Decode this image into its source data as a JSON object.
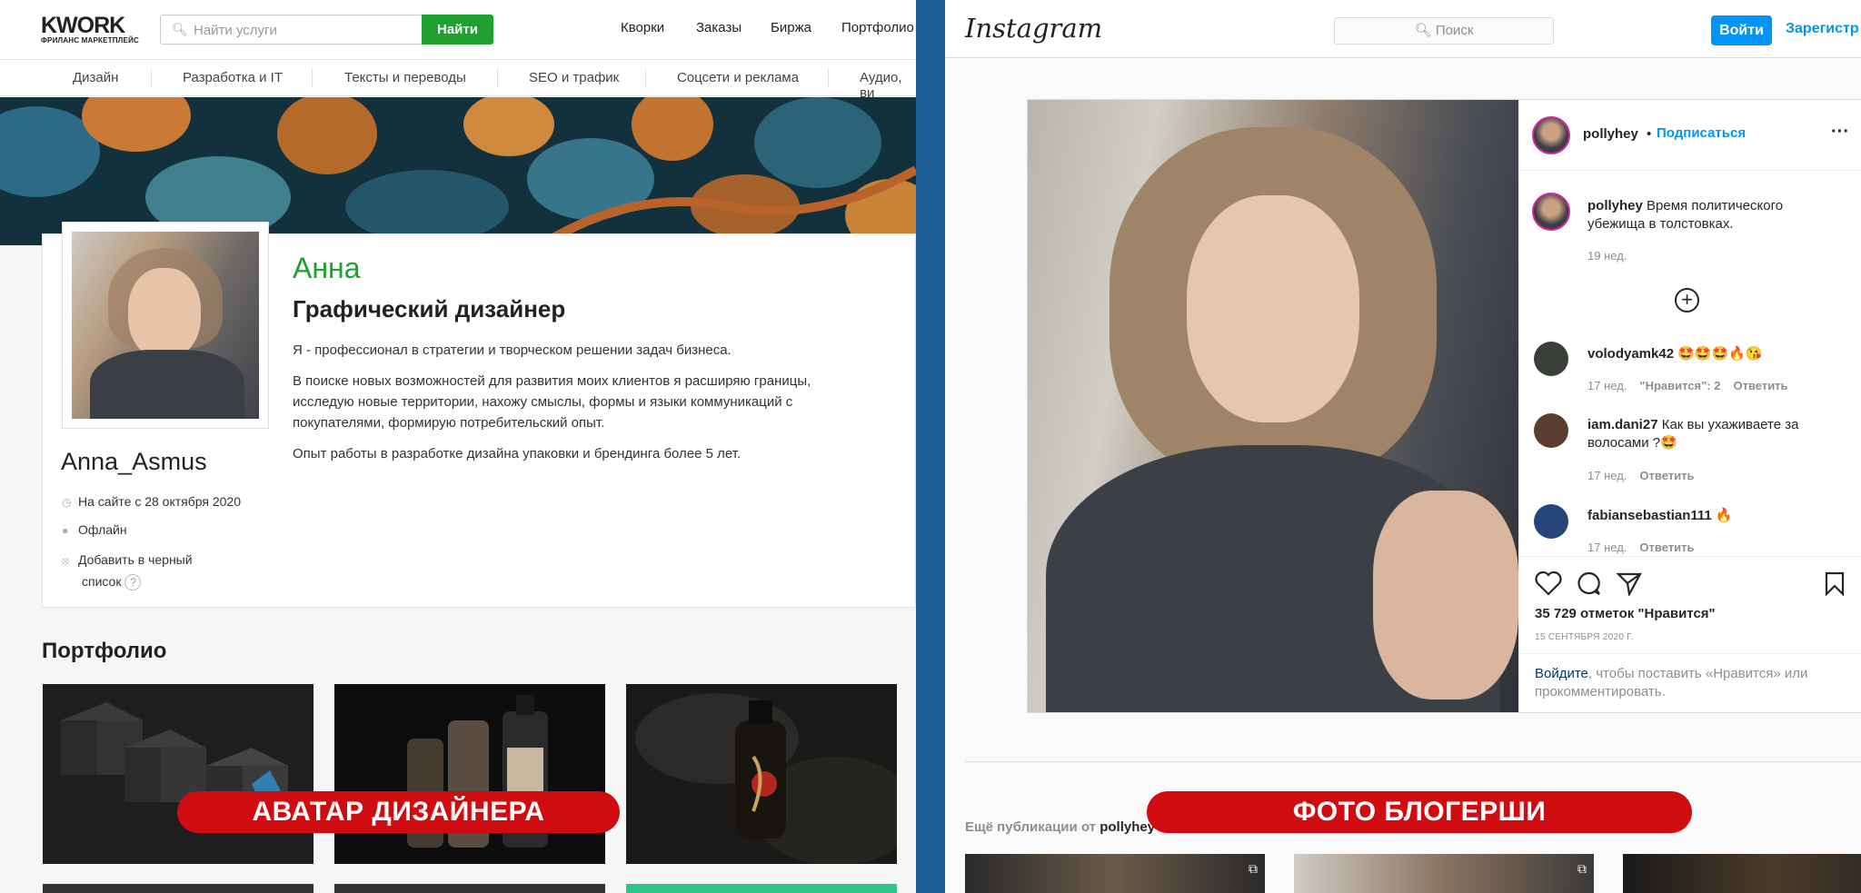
{
  "kwork": {
    "logo": "KWORK",
    "logo_sub": "ФРИЛАНС МАРКЕТПЛЕЙС",
    "search_placeholder": "Найти услуги",
    "search_button": "Найти",
    "nav": [
      "Кворки",
      "Заказы",
      "Биржа",
      "Портфолио"
    ],
    "categories": [
      "Дизайн",
      "Разработка и IT",
      "Тексты и переводы",
      "SEO и трафик",
      "Соцсети и реклама",
      "Аудио, ви"
    ],
    "profile": {
      "first_name": "Анна",
      "role": "Графический дизайнер",
      "bio": [
        "Я - профессионал в стратегии и творческом решении задач бизнеса.",
        "В поиске новых возможностей для развития моих клиентов я расширяю границы, исследую новые территории, нахожу смыслы, формы и языки коммуникаций с покупателями, формирую потребительский опыт.",
        "Опыт работы в разработке дизайна упаковки и брендинга более 5 лет."
      ],
      "username": "Anna_Asmus",
      "since": "На сайте с 28 октября 2020",
      "status": "Офлайн",
      "blacklist": "Добавить в черный",
      "blacklist_2": "список",
      "help_icon": "?"
    },
    "portfolio_title": "Портфолио"
  },
  "instagram": {
    "logo": "Instagram",
    "search_placeholder": "Поиск",
    "login_button": "Войти",
    "signup_link": "Зарегистр",
    "post": {
      "username": "pollyhey",
      "follow": "Подписаться",
      "dot": "•",
      "more": "···",
      "caption": "Время политического убежища в толстовках.",
      "caption_time": "19 нед.",
      "comments": [
        {
          "user": "volodyamk42",
          "text": "🤩🤩🤩🔥😘",
          "time": "17 нед.",
          "likes": "\"Нравится\": 2",
          "reply": "Ответить"
        },
        {
          "user": "iam.dani27",
          "text": "Как вы ухаживаете за волосами ?🤩",
          "time": "17 нед.",
          "likes": "",
          "reply": "Ответить"
        },
        {
          "user": "fabiansebastian111",
          "text": "🔥",
          "time": "17 нед.",
          "likes": "",
          "reply": "Ответить"
        }
      ],
      "likes": "35 729 отметок \"Нравится\"",
      "date": "15 СЕНТЯБРЯ 2020 Г.",
      "login_link": "Войдите",
      "login_text": ", чтобы поставить «Нравится» или прокомментировать."
    },
    "more_posts": "Ещё публикации от",
    "more_posts_user": "pollyhey"
  },
  "banners": {
    "left": "АВАТАР ДИЗАЙНЕРА",
    "right": "ФОТО БЛОГЕРШИ"
  },
  "colors": {
    "kwork_green": "#1fa12f",
    "instagram_blue": "#0095f6",
    "banner_red": "#d10c10",
    "divider_blue": "#1e5d95"
  }
}
